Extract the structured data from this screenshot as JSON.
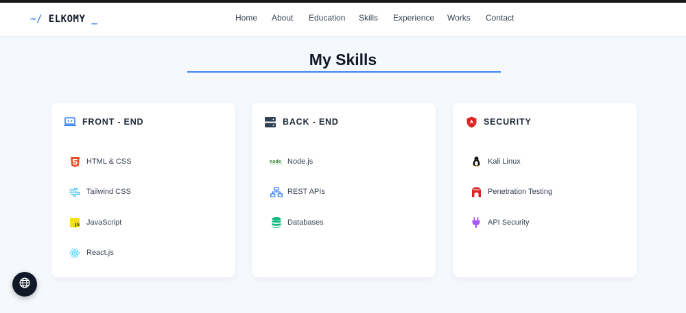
{
  "header": {
    "logo_prefix": "~/",
    "logo_name": "ELKOMY",
    "logo_cursor": "_",
    "nav": [
      "Home",
      "About",
      "Education",
      "Skills",
      "Experience",
      "Works",
      "Contact"
    ]
  },
  "section": {
    "title": "My Skills"
  },
  "cards": [
    {
      "title": "FRONT - END",
      "icon": "laptop-code-icon",
      "skills": [
        {
          "label": "HTML & CSS",
          "icon": "html5-icon"
        },
        {
          "label": "Tailwind CSS",
          "icon": "tailwind-icon"
        },
        {
          "label": "JavaScript",
          "icon": "javascript-icon"
        },
        {
          "label": "React.js",
          "icon": "react-icon"
        }
      ]
    },
    {
      "title": "BACK - END",
      "icon": "server-icon",
      "skills": [
        {
          "label": "Node.js",
          "icon": "nodejs-icon"
        },
        {
          "label": "REST APIs",
          "icon": "network-icon"
        },
        {
          "label": "Databases",
          "icon": "database-icon"
        }
      ]
    },
    {
      "title": "SECURITY",
      "icon": "shield-icon",
      "skills": [
        {
          "label": "Kali Linux",
          "icon": "linux-icon"
        },
        {
          "label": "Penetration Testing",
          "icon": "dungeon-icon"
        },
        {
          "label": "API Security",
          "icon": "plug-icon"
        }
      ]
    }
  ],
  "colors": {
    "accent": "#3b82f6",
    "background": "#f5f8fc",
    "card": "#ffffff",
    "text_dark": "#111827",
    "fab": "#111827"
  },
  "floating_button": {
    "icon": "globe-icon"
  }
}
